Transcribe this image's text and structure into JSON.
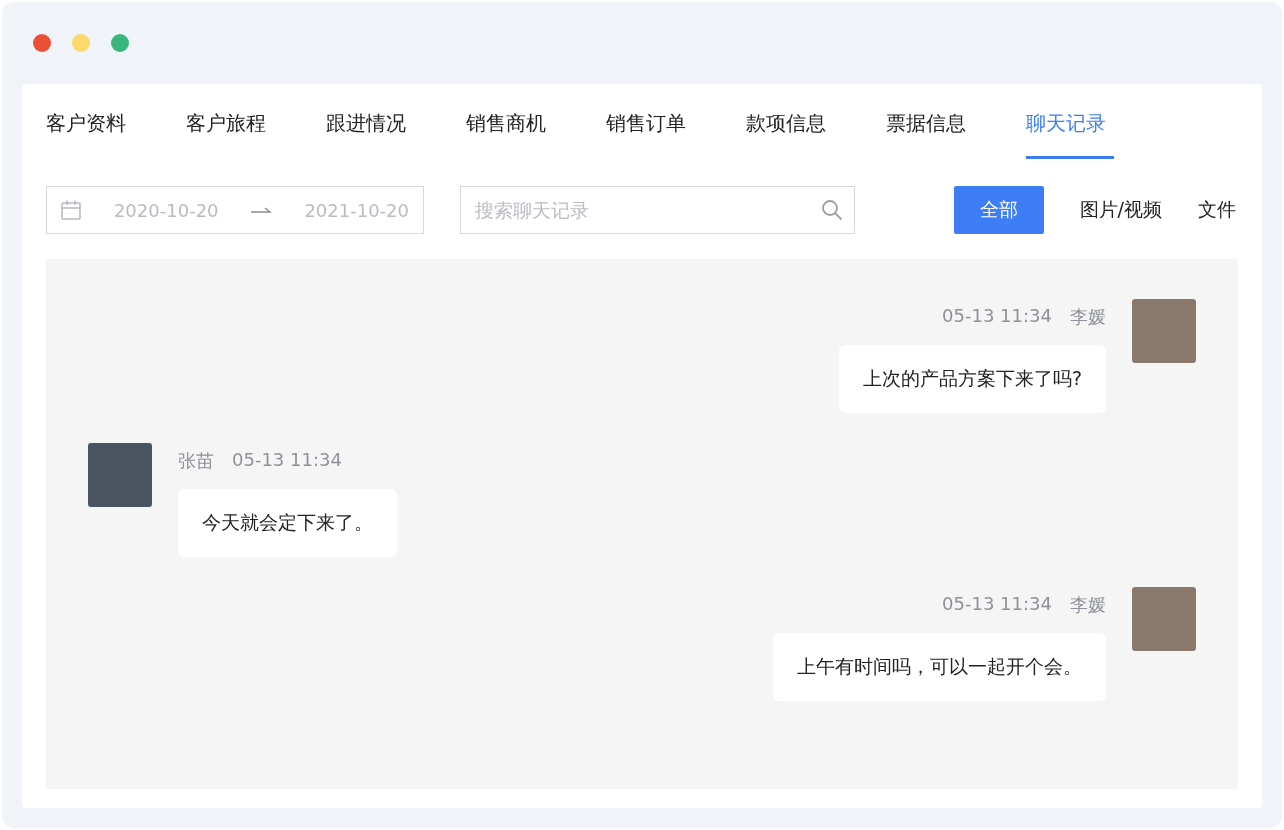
{
  "tabs": [
    {
      "label": "客户资料",
      "selected": false
    },
    {
      "label": "客户旅程",
      "selected": false
    },
    {
      "label": "跟进情况",
      "selected": false
    },
    {
      "label": "销售商机",
      "selected": false
    },
    {
      "label": "销售订单",
      "selected": false
    },
    {
      "label": "款项信息",
      "selected": false
    },
    {
      "label": "票据信息",
      "selected": false
    },
    {
      "label": "聊天记录",
      "selected": true
    }
  ],
  "date_range": {
    "start": "2020-10-20",
    "end": "2021-10-20"
  },
  "search": {
    "placeholder": "搜索聊天记录"
  },
  "filters": [
    {
      "label": "全部",
      "selected": true
    },
    {
      "label": "图片/视频",
      "selected": false
    },
    {
      "label": "文件",
      "selected": false
    }
  ],
  "messages": [
    {
      "kind": "sent",
      "sender": "李媛",
      "time": "05-13 11:34",
      "text": "上次的产品方案下来了吗?"
    },
    {
      "kind": "received",
      "sender": "张苗",
      "time": "05-13 11:34",
      "text": "今天就会定下来了。"
    },
    {
      "kind": "sent",
      "sender": "李媛",
      "time": "05-13 11:34",
      "text": "上午有时间吗，可以一起开个会。"
    }
  ]
}
